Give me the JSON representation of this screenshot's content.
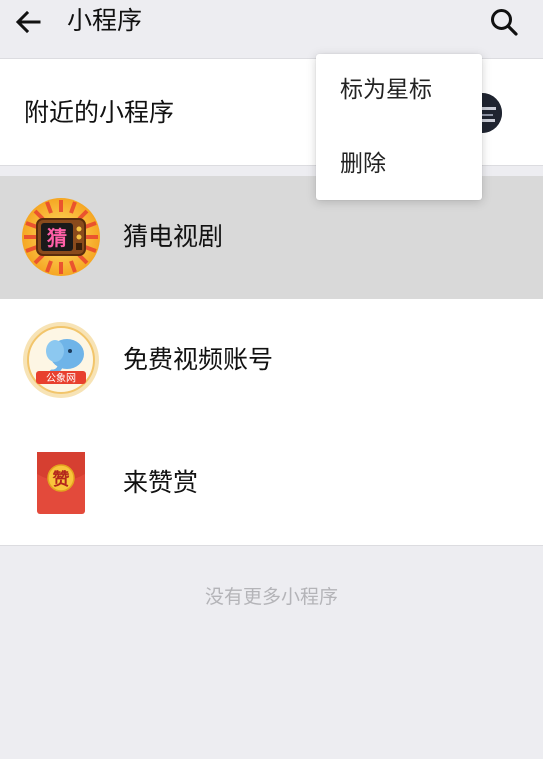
{
  "header": {
    "title": "小程序",
    "back_icon": "arrow-left-icon",
    "search_icon": "search-icon"
  },
  "nearby": {
    "label": "附近的小程序"
  },
  "popup_menu": {
    "items": [
      {
        "label": "标为星标"
      },
      {
        "label": "删除"
      }
    ]
  },
  "mini_programs": [
    {
      "name": "猜电视剧",
      "icon": "tv-guess-icon",
      "icon_text": "猜",
      "selected": true
    },
    {
      "name": "免费视频账号",
      "icon": "elephant-icon",
      "icon_text": "公象网",
      "selected": false
    },
    {
      "name": "来赞赏",
      "icon": "red-envelope-icon",
      "icon_text": "赞",
      "selected": false
    }
  ],
  "footer": {
    "text": "没有更多小程序"
  },
  "colors": {
    "background": "#ededf1",
    "selected_row": "#d9d9d9",
    "footer_text": "#b4b4b8"
  }
}
